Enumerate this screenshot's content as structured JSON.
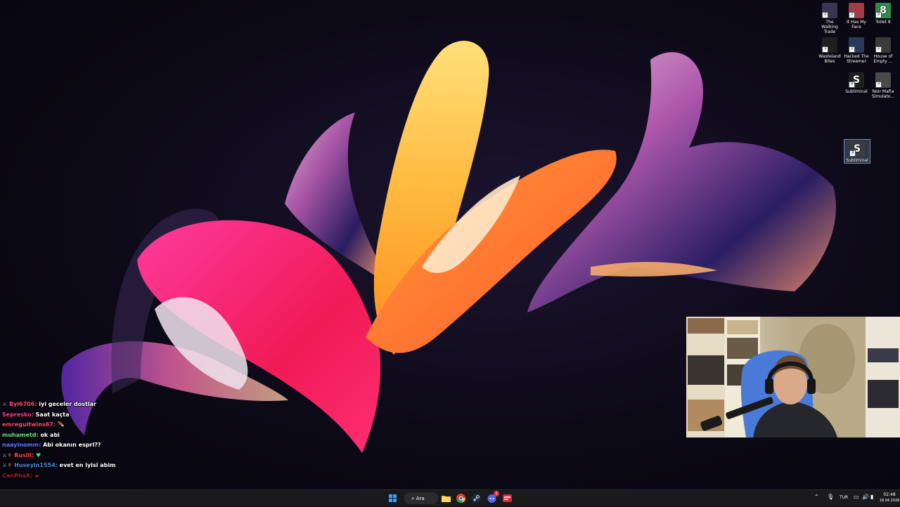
{
  "desktop": {
    "icons": [
      {
        "label": "The Walking Trade",
        "icon": "game-shortcut-icon",
        "color": "#3a3550"
      },
      {
        "label": "It Has My Face",
        "icon": "game-shortcut-icon",
        "color": "#a43b48"
      },
      {
        "label": "Toilet 8",
        "icon": "game-shortcut-icon",
        "color": "#2f8a4c"
      },
      {
        "label": "Wasteland Bites",
        "icon": "game-shortcut-icon",
        "color": "#1f1f1f"
      },
      {
        "label": "Hacked The Streamer",
        "icon": "game-shortcut-icon",
        "color": "#2a3a5a"
      },
      {
        "label": "House of Empty ...",
        "icon": "game-shortcut-icon",
        "color": "#3a3a3a"
      },
      {
        "label": "Subliminal",
        "icon": "game-shortcut-icon",
        "color": "#202020"
      },
      {
        "label": "Noir Mafia Simulato...",
        "icon": "game-shortcut-icon",
        "color": "#4a4a4a"
      },
      {
        "label": "Subliminal",
        "icon": "game-shortcut-icon",
        "color": "#3b3b40"
      }
    ],
    "toilet_badge": "8",
    "subliminal_glyph": "S"
  },
  "chat": {
    "messages": [
      {
        "user": "Byl6706:",
        "user_color": "#ff4a6a",
        "text": "iyi geceler dostlar",
        "badge": "sword-icon"
      },
      {
        "user": "Sepresko:",
        "user_color": "#ff3b8a",
        "text": "Saat kaçta",
        "badge": ""
      },
      {
        "user": "emreguitwins67:",
        "user_color": "#ff4a6a",
        "text": "",
        "badge": ""
      },
      {
        "user": "muhametd:",
        "user_color": "#6ee07a",
        "text": "ok abi",
        "badge": ""
      },
      {
        "user": "naayinomm:",
        "user_color": "#5a7cff",
        "text": "Abi okanın esprl??",
        "badge": ""
      },
      {
        "user": "Ruslll:",
        "user_color": "#ff4a4a",
        "text": "",
        "badge": "sword-icon"
      },
      {
        "user": "Huseyin1554:",
        "user_color": "#4a8ad8",
        "text": "evet en iyisi abim",
        "badge": "sword-icon"
      },
      {
        "user": "CanPhaX:",
        "user_color": "#a0202a",
        "text": "",
        "badge": ""
      }
    ]
  },
  "taskbar": {
    "search_label": "Ara",
    "language": "TUR",
    "time": "02:48",
    "date": "18.04.2026",
    "apps": [
      "file-explorer-icon",
      "chrome-icon",
      "steam-icon",
      "discord-icon",
      "streaming-app-icon"
    ],
    "discord_badge": "1"
  },
  "colors": {
    "taskbar_bg": "#1a1a1c",
    "accent": "#2a7fff"
  }
}
